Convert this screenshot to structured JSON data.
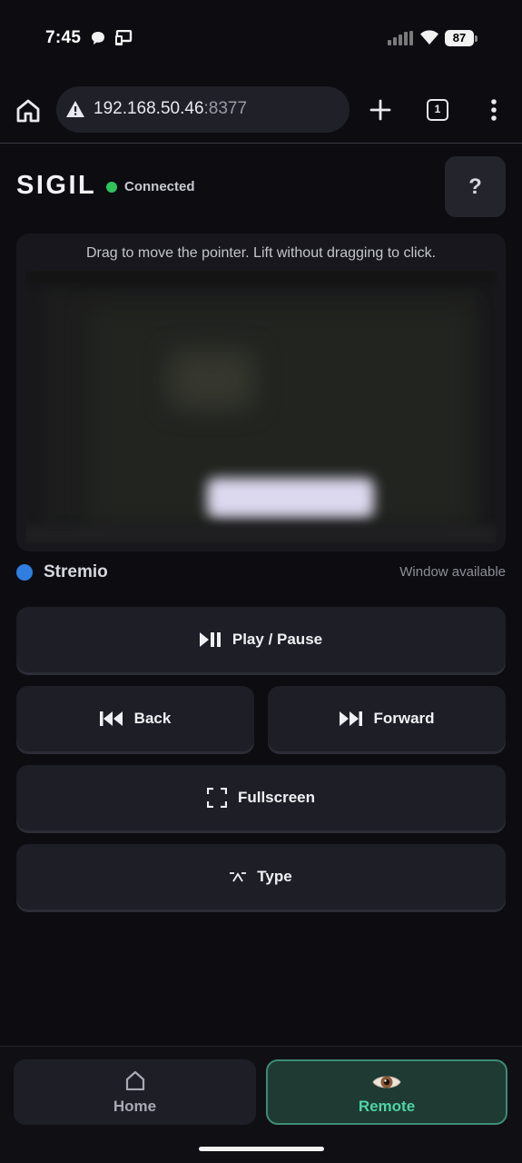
{
  "status_bar": {
    "time": "7:45",
    "battery": "87"
  },
  "browser": {
    "url_host": "192.168.50.46",
    "url_port": ":8377",
    "tab_count": "1"
  },
  "app": {
    "title": "SIGIL",
    "connection_status": "Connected",
    "help_label": "?"
  },
  "preview": {
    "hint": "Drag to move the pointer. Lift without dragging to click."
  },
  "window": {
    "app_name": "Stremio",
    "status": "Window available"
  },
  "controls": {
    "play_pause": "Play / Pause",
    "back": "Back",
    "forward": "Forward",
    "fullscreen": "Fullscreen",
    "type": "Type"
  },
  "nav": {
    "home": "Home",
    "remote": "Remote"
  },
  "colors": {
    "background": "#0c0c11",
    "button": "#1e1e27",
    "connected": "#2fc35a",
    "app_indicator": "#2f7ee0",
    "active_nav_bg": "#1e3a33",
    "active_nav_text": "#4fd3a4"
  }
}
